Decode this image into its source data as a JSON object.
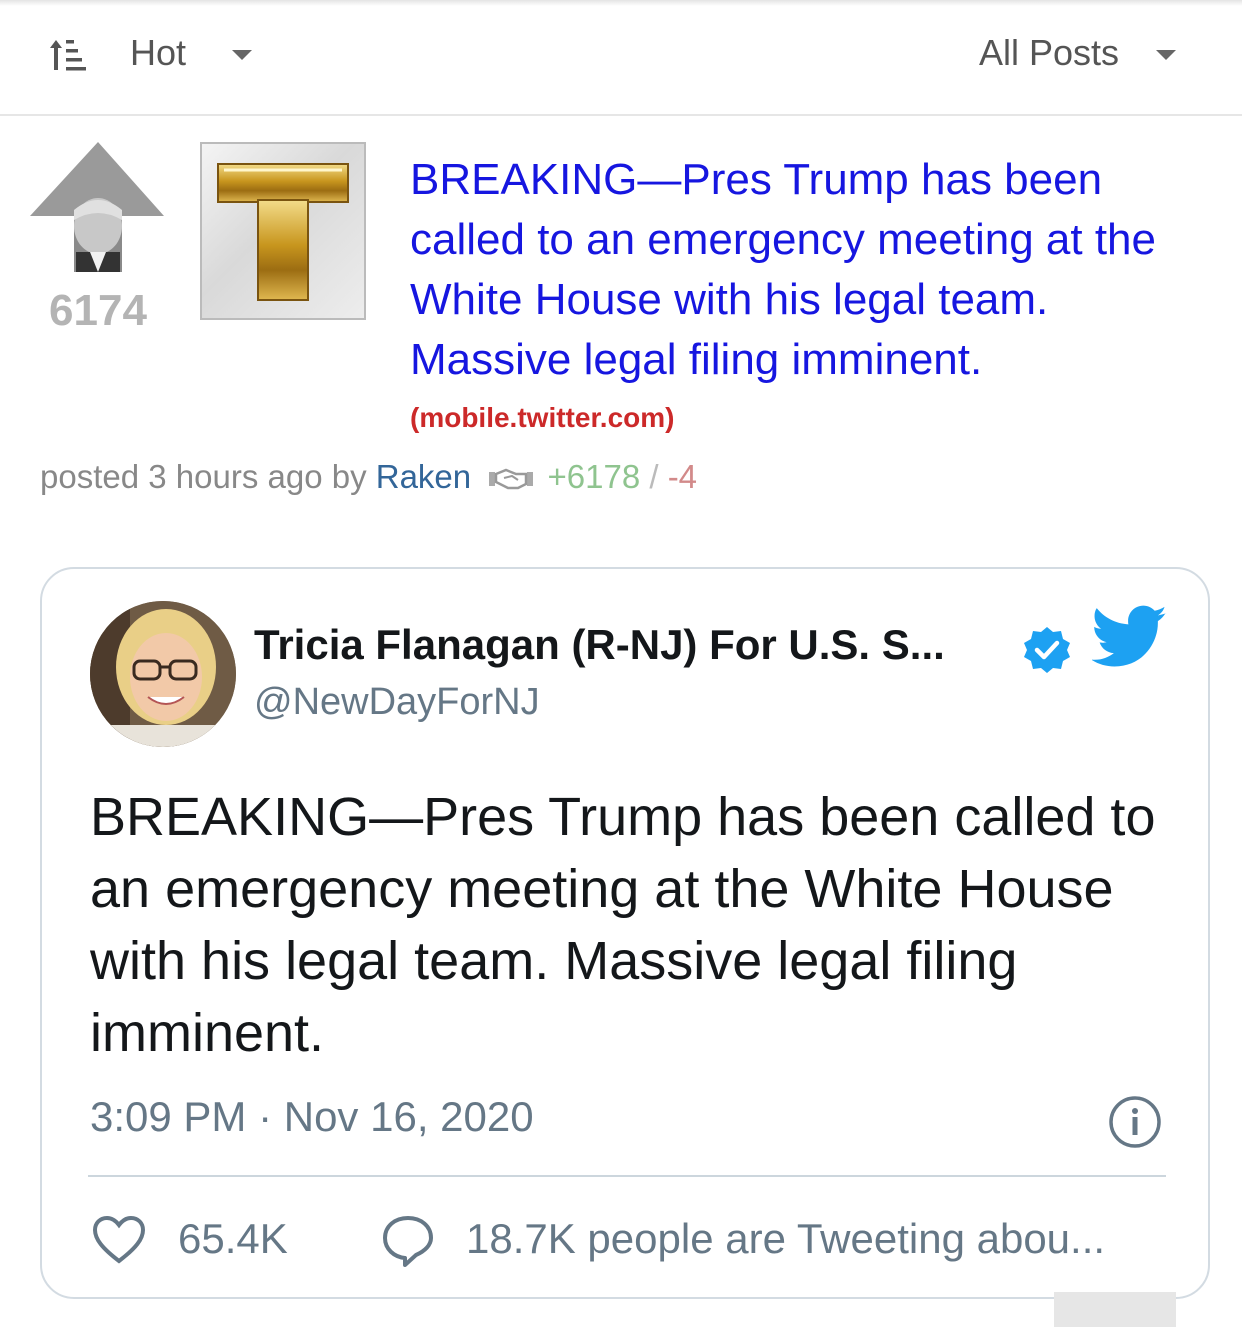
{
  "toolbar": {
    "sort_label": "Hot",
    "filter_label": "All Posts"
  },
  "post": {
    "score": "6174",
    "title": "BREAKING—Pres Trump has been called to an emergency meeting at the White House with his legal team. Massive legal filing imminent.",
    "domain": "(mobile.twitter.com)",
    "meta_prefix": "posted 3 hours ago by",
    "author": "Raken",
    "upvotes": "+6178",
    "separator": "/",
    "downvotes": "-4"
  },
  "tweet": {
    "display_name": "Tricia Flanagan (R-NJ) For U.S. S...",
    "handle": "@NewDayForNJ",
    "text": "BREAKING—Pres Trump has been called to an emergency meeting at the White House with his legal team.  Massive legal filing imminent.",
    "time": "3:09 PM · Nov 16, 2020",
    "like_count": "65.4K",
    "reply_text": "18.7K people are Tweeting abou..."
  },
  "colors": {
    "title_link": "#1616e0",
    "domain": "#cc2929",
    "author": "#336699",
    "upvotes": "#8fc48f",
    "downvotes": "#d28a8a",
    "twitter_blue": "#1da1f2"
  }
}
